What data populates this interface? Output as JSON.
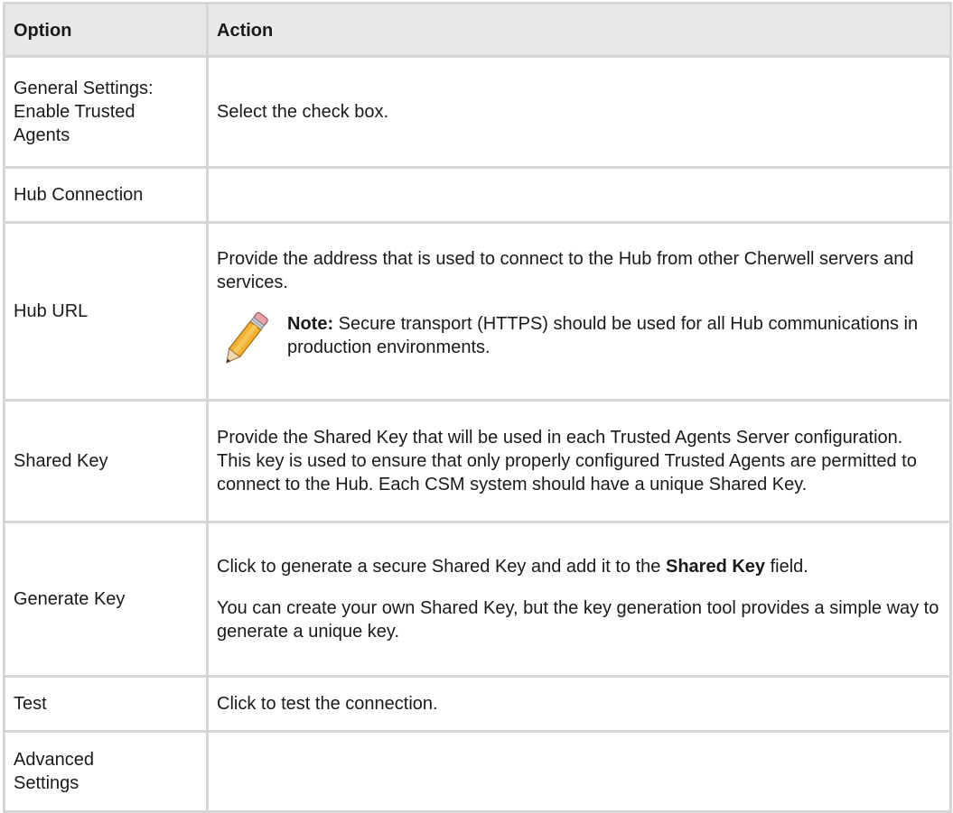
{
  "table": {
    "header": {
      "option": "Option",
      "action": "Action"
    },
    "general": {
      "option": "General Settings: Enable Trusted Agents",
      "action": "Select the check box."
    },
    "hub_connection": {
      "option": "Hub Connection",
      "action": ""
    },
    "hub_url": {
      "option": "Hub URL",
      "action": "Provide the address that is used to connect to the Hub from other Cherwell servers and services.",
      "note_label": "Note:",
      "note_text": " Secure transport (HTTPS) should be used for all Hub communications in production environments.",
      "note_icon": "pencil-icon"
    },
    "shared_key": {
      "option": "Shared Key",
      "action": "Provide the Shared Key that will be used in each Trusted Agents Server configuration. This key is used to ensure that only properly configured Trusted Agents are permitted to connect to the Hub. Each CSM system should have a unique Shared Key."
    },
    "generate_key": {
      "option": "Generate Key",
      "action_pre": "Click to generate a secure Shared Key and add it to the ",
      "action_bold": "Shared Key",
      "action_post": " field.",
      "action2": "You can create your own Shared Key, but the key generation tool provides a simple way to generate a unique key."
    },
    "test": {
      "option": "Test",
      "action": "Click to test the connection."
    },
    "advanced": {
      "option": "Advanced Settings",
      "action": ""
    }
  }
}
